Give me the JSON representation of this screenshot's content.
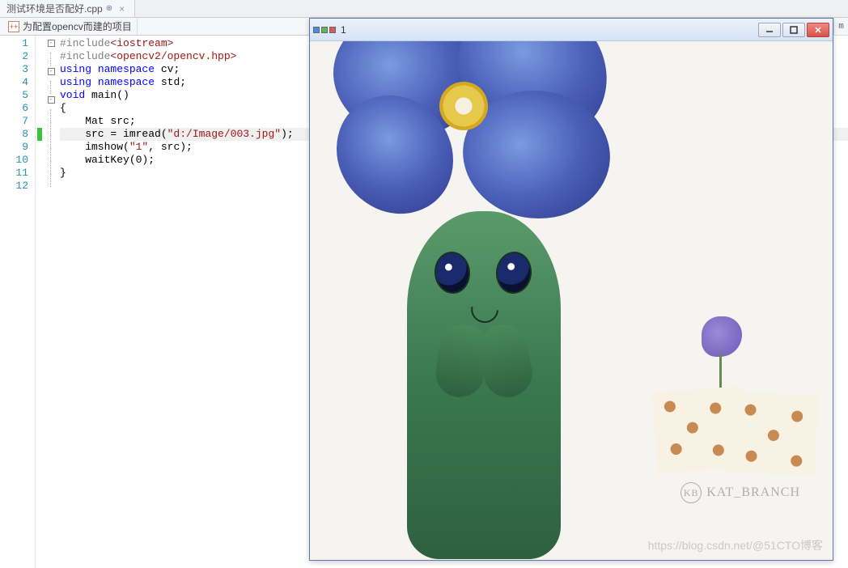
{
  "tab": {
    "filename": "测试环境是否配好.cpp",
    "close_glyph": "×"
  },
  "nav": {
    "project_name": "为配置opencv而建的项目"
  },
  "right_bar": {
    "label": "m"
  },
  "code": {
    "lines": [
      {
        "n": 1,
        "fold": "box",
        "text": "#include<iostream>"
      },
      {
        "n": 2,
        "fold": "line",
        "text": "#include<opencv2/opencv.hpp>"
      },
      {
        "n": 3,
        "fold": "box",
        "text": "using namespace cv;"
      },
      {
        "n": 4,
        "fold": "line",
        "text": "using namespace std;"
      },
      {
        "n": 5,
        "fold": "box",
        "text": "void main()"
      },
      {
        "n": 6,
        "fold": "line",
        "text": "{"
      },
      {
        "n": 7,
        "fold": "line",
        "text": "    Mat src;"
      },
      {
        "n": 8,
        "fold": "line",
        "text": "    src = imread(\"d:/Image/003.jpg\");",
        "current": true,
        "marker": "green"
      },
      {
        "n": 9,
        "fold": "line",
        "text": "    imshow(\"1\", src);"
      },
      {
        "n": 10,
        "fold": "line",
        "text": "    waitKey(0);"
      },
      {
        "n": 11,
        "fold": "line",
        "text": "}"
      },
      {
        "n": 12,
        "fold": "",
        "text": ""
      }
    ],
    "tokens": {
      "1": [
        {
          "t": "#include",
          "c": "pp"
        },
        {
          "t": "<iostream>",
          "c": "inc"
        }
      ],
      "2": [
        {
          "t": "#include",
          "c": "pp"
        },
        {
          "t": "<opencv2/opencv.hpp>",
          "c": "inc"
        }
      ],
      "3": [
        {
          "t": "using",
          "c": "kw"
        },
        {
          "t": " ",
          "c": ""
        },
        {
          "t": "namespace",
          "c": "kw"
        },
        {
          "t": " cv;",
          "c": ""
        }
      ],
      "4": [
        {
          "t": "using",
          "c": "kw"
        },
        {
          "t": " ",
          "c": ""
        },
        {
          "t": "namespace",
          "c": "kw"
        },
        {
          "t": " std;",
          "c": ""
        }
      ],
      "5": [
        {
          "t": "void",
          "c": "type"
        },
        {
          "t": " main()",
          "c": ""
        }
      ],
      "6": [
        {
          "t": "{",
          "c": ""
        }
      ],
      "7": [
        {
          "t": "    Mat src;",
          "c": ""
        }
      ],
      "8": [
        {
          "t": "    src = imread(",
          "c": ""
        },
        {
          "t": "\"d:/Image/003.jpg\"",
          "c": "str"
        },
        {
          "t": ");",
          "c": ""
        }
      ],
      "9": [
        {
          "t": "    imshow(",
          "c": ""
        },
        {
          "t": "\"1\"",
          "c": "str"
        },
        {
          "t": ", src);",
          "c": ""
        }
      ],
      "10": [
        {
          "t": "    waitKey(0);",
          "c": ""
        }
      ],
      "11": [
        {
          "t": "}",
          "c": ""
        }
      ],
      "12": [
        {
          "t": "",
          "c": ""
        }
      ]
    }
  },
  "image_window": {
    "title": "1",
    "signature": "KAT_BRANCH",
    "sig_mono": "KB",
    "watermark": "https://blog.csdn.net/@51CTO博客"
  }
}
